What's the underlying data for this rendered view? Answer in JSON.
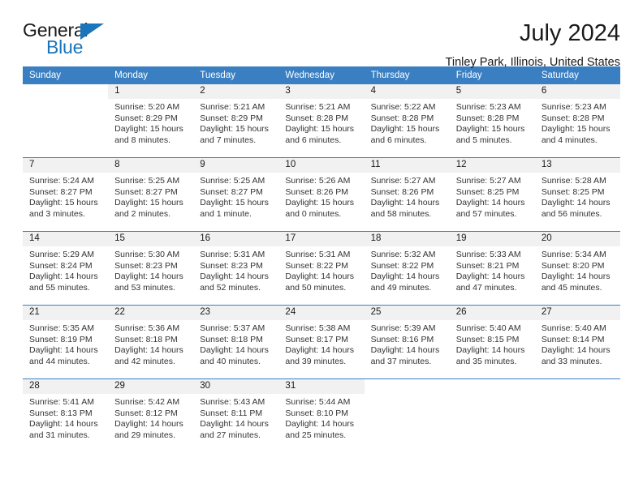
{
  "logo": {
    "word_top": "General",
    "word_bottom": "Blue",
    "accent_color": "#1b75bb"
  },
  "header": {
    "title": "July 2024",
    "subtitle": "Tinley Park, Illinois, United States"
  },
  "theme": {
    "header_blue": "#3a7fc1",
    "daynum_bg": "#f1f1f1",
    "text": "#333333"
  },
  "calendar": {
    "weekday_headers": [
      "Sunday",
      "Monday",
      "Tuesday",
      "Wednesday",
      "Thursday",
      "Friday",
      "Saturday"
    ],
    "labels": {
      "sunrise": "Sunrise:",
      "sunset": "Sunset:",
      "daylight": "Daylight:"
    },
    "weeks": [
      [
        {
          "day": "",
          "sunrise": "",
          "sunset": "",
          "daylight_line1": "",
          "daylight_line2": ""
        },
        {
          "day": "1",
          "sunrise": "Sunrise: 5:20 AM",
          "sunset": "Sunset: 8:29 PM",
          "daylight_line1": "Daylight: 15 hours",
          "daylight_line2": "and 8 minutes."
        },
        {
          "day": "2",
          "sunrise": "Sunrise: 5:21 AM",
          "sunset": "Sunset: 8:29 PM",
          "daylight_line1": "Daylight: 15 hours",
          "daylight_line2": "and 7 minutes."
        },
        {
          "day": "3",
          "sunrise": "Sunrise: 5:21 AM",
          "sunset": "Sunset: 8:28 PM",
          "daylight_line1": "Daylight: 15 hours",
          "daylight_line2": "and 6 minutes."
        },
        {
          "day": "4",
          "sunrise": "Sunrise: 5:22 AM",
          "sunset": "Sunset: 8:28 PM",
          "daylight_line1": "Daylight: 15 hours",
          "daylight_line2": "and 6 minutes."
        },
        {
          "day": "5",
          "sunrise": "Sunrise: 5:23 AM",
          "sunset": "Sunset: 8:28 PM",
          "daylight_line1": "Daylight: 15 hours",
          "daylight_line2": "and 5 minutes."
        },
        {
          "day": "6",
          "sunrise": "Sunrise: 5:23 AM",
          "sunset": "Sunset: 8:28 PM",
          "daylight_line1": "Daylight: 15 hours",
          "daylight_line2": "and 4 minutes."
        }
      ],
      [
        {
          "day": "7",
          "sunrise": "Sunrise: 5:24 AM",
          "sunset": "Sunset: 8:27 PM",
          "daylight_line1": "Daylight: 15 hours",
          "daylight_line2": "and 3 minutes."
        },
        {
          "day": "8",
          "sunrise": "Sunrise: 5:25 AM",
          "sunset": "Sunset: 8:27 PM",
          "daylight_line1": "Daylight: 15 hours",
          "daylight_line2": "and 2 minutes."
        },
        {
          "day": "9",
          "sunrise": "Sunrise: 5:25 AM",
          "sunset": "Sunset: 8:27 PM",
          "daylight_line1": "Daylight: 15 hours",
          "daylight_line2": "and 1 minute."
        },
        {
          "day": "10",
          "sunrise": "Sunrise: 5:26 AM",
          "sunset": "Sunset: 8:26 PM",
          "daylight_line1": "Daylight: 15 hours",
          "daylight_line2": "and 0 minutes."
        },
        {
          "day": "11",
          "sunrise": "Sunrise: 5:27 AM",
          "sunset": "Sunset: 8:26 PM",
          "daylight_line1": "Daylight: 14 hours",
          "daylight_line2": "and 58 minutes."
        },
        {
          "day": "12",
          "sunrise": "Sunrise: 5:27 AM",
          "sunset": "Sunset: 8:25 PM",
          "daylight_line1": "Daylight: 14 hours",
          "daylight_line2": "and 57 minutes."
        },
        {
          "day": "13",
          "sunrise": "Sunrise: 5:28 AM",
          "sunset": "Sunset: 8:25 PM",
          "daylight_line1": "Daylight: 14 hours",
          "daylight_line2": "and 56 minutes."
        }
      ],
      [
        {
          "day": "14",
          "sunrise": "Sunrise: 5:29 AM",
          "sunset": "Sunset: 8:24 PM",
          "daylight_line1": "Daylight: 14 hours",
          "daylight_line2": "and 55 minutes."
        },
        {
          "day": "15",
          "sunrise": "Sunrise: 5:30 AM",
          "sunset": "Sunset: 8:23 PM",
          "daylight_line1": "Daylight: 14 hours",
          "daylight_line2": "and 53 minutes."
        },
        {
          "day": "16",
          "sunrise": "Sunrise: 5:31 AM",
          "sunset": "Sunset: 8:23 PM",
          "daylight_line1": "Daylight: 14 hours",
          "daylight_line2": "and 52 minutes."
        },
        {
          "day": "17",
          "sunrise": "Sunrise: 5:31 AM",
          "sunset": "Sunset: 8:22 PM",
          "daylight_line1": "Daylight: 14 hours",
          "daylight_line2": "and 50 minutes."
        },
        {
          "day": "18",
          "sunrise": "Sunrise: 5:32 AM",
          "sunset": "Sunset: 8:22 PM",
          "daylight_line1": "Daylight: 14 hours",
          "daylight_line2": "and 49 minutes."
        },
        {
          "day": "19",
          "sunrise": "Sunrise: 5:33 AM",
          "sunset": "Sunset: 8:21 PM",
          "daylight_line1": "Daylight: 14 hours",
          "daylight_line2": "and 47 minutes."
        },
        {
          "day": "20",
          "sunrise": "Sunrise: 5:34 AM",
          "sunset": "Sunset: 8:20 PM",
          "daylight_line1": "Daylight: 14 hours",
          "daylight_line2": "and 45 minutes."
        }
      ],
      [
        {
          "day": "21",
          "sunrise": "Sunrise: 5:35 AM",
          "sunset": "Sunset: 8:19 PM",
          "daylight_line1": "Daylight: 14 hours",
          "daylight_line2": "and 44 minutes."
        },
        {
          "day": "22",
          "sunrise": "Sunrise: 5:36 AM",
          "sunset": "Sunset: 8:18 PM",
          "daylight_line1": "Daylight: 14 hours",
          "daylight_line2": "and 42 minutes."
        },
        {
          "day": "23",
          "sunrise": "Sunrise: 5:37 AM",
          "sunset": "Sunset: 8:18 PM",
          "daylight_line1": "Daylight: 14 hours",
          "daylight_line2": "and 40 minutes."
        },
        {
          "day": "24",
          "sunrise": "Sunrise: 5:38 AM",
          "sunset": "Sunset: 8:17 PM",
          "daylight_line1": "Daylight: 14 hours",
          "daylight_line2": "and 39 minutes."
        },
        {
          "day": "25",
          "sunrise": "Sunrise: 5:39 AM",
          "sunset": "Sunset: 8:16 PM",
          "daylight_line1": "Daylight: 14 hours",
          "daylight_line2": "and 37 minutes."
        },
        {
          "day": "26",
          "sunrise": "Sunrise: 5:40 AM",
          "sunset": "Sunset: 8:15 PM",
          "daylight_line1": "Daylight: 14 hours",
          "daylight_line2": "and 35 minutes."
        },
        {
          "day": "27",
          "sunrise": "Sunrise: 5:40 AM",
          "sunset": "Sunset: 8:14 PM",
          "daylight_line1": "Daylight: 14 hours",
          "daylight_line2": "and 33 minutes."
        }
      ],
      [
        {
          "day": "28",
          "sunrise": "Sunrise: 5:41 AM",
          "sunset": "Sunset: 8:13 PM",
          "daylight_line1": "Daylight: 14 hours",
          "daylight_line2": "and 31 minutes."
        },
        {
          "day": "29",
          "sunrise": "Sunrise: 5:42 AM",
          "sunset": "Sunset: 8:12 PM",
          "daylight_line1": "Daylight: 14 hours",
          "daylight_line2": "and 29 minutes."
        },
        {
          "day": "30",
          "sunrise": "Sunrise: 5:43 AM",
          "sunset": "Sunset: 8:11 PM",
          "daylight_line1": "Daylight: 14 hours",
          "daylight_line2": "and 27 minutes."
        },
        {
          "day": "31",
          "sunrise": "Sunrise: 5:44 AM",
          "sunset": "Sunset: 8:10 PM",
          "daylight_line1": "Daylight: 14 hours",
          "daylight_line2": "and 25 minutes."
        },
        {
          "day": "",
          "sunrise": "",
          "sunset": "",
          "daylight_line1": "",
          "daylight_line2": ""
        },
        {
          "day": "",
          "sunrise": "",
          "sunset": "",
          "daylight_line1": "",
          "daylight_line2": ""
        },
        {
          "day": "",
          "sunrise": "",
          "sunset": "",
          "daylight_line1": "",
          "daylight_line2": ""
        }
      ]
    ]
  }
}
